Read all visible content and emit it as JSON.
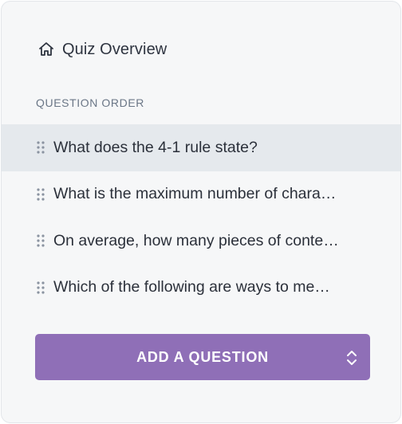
{
  "overview": {
    "label": "Quiz Overview",
    "icon": "home-icon"
  },
  "section_label": "QUESTION ORDER",
  "questions": [
    {
      "text": "What does the 4-1 rule state?",
      "active": true
    },
    {
      "text": "What is the maximum number of chara…",
      "active": false
    },
    {
      "text": "On average, how many pieces of conte…",
      "active": false
    },
    {
      "text": "Which of the following are ways to me…",
      "active": false
    }
  ],
  "add_button": {
    "label": "ADD A QUESTION",
    "icon": "sort-icon"
  },
  "colors": {
    "accent": "#8f6fb7",
    "active_row": "#e5e9ed",
    "panel_bg": "#f6f7f8"
  }
}
